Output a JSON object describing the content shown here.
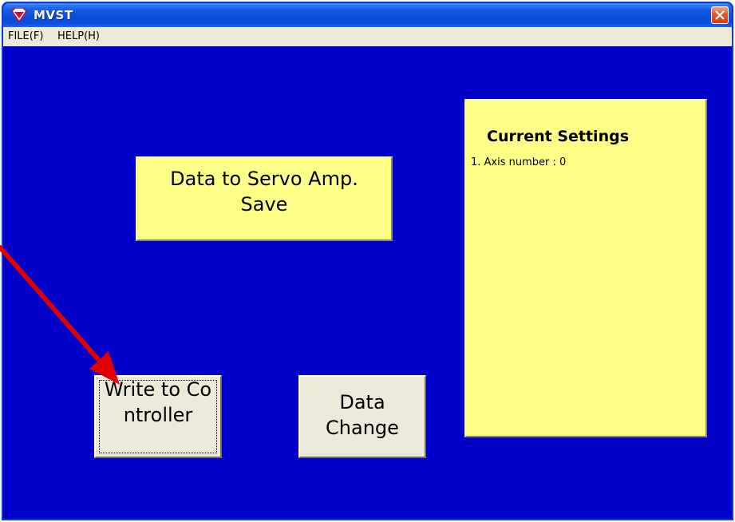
{
  "window": {
    "title": "MVST",
    "close_icon": "close-icon",
    "app_icon": "diamond-app-icon"
  },
  "menubar": {
    "items": [
      {
        "label": "FILE(F)"
      },
      {
        "label": "HELP(H)"
      }
    ]
  },
  "main": {
    "save_box": {
      "line1": "Data to Servo Amp.",
      "line2": "Save"
    },
    "settings": {
      "title": "Current Settings",
      "lines": [
        "1. Axis number : 0"
      ]
    },
    "buttons": {
      "write_controller": "Write to Controller",
      "data_change_line1": "Data",
      "data_change_line2": "Change"
    }
  },
  "annotation": {
    "arrow_color": "#e00000",
    "arrow_icon": "red-pointer-arrow"
  },
  "colors": {
    "client_background": "#0000c8",
    "label_yellow": "#ffff88",
    "button_face": "#ece9d8"
  }
}
